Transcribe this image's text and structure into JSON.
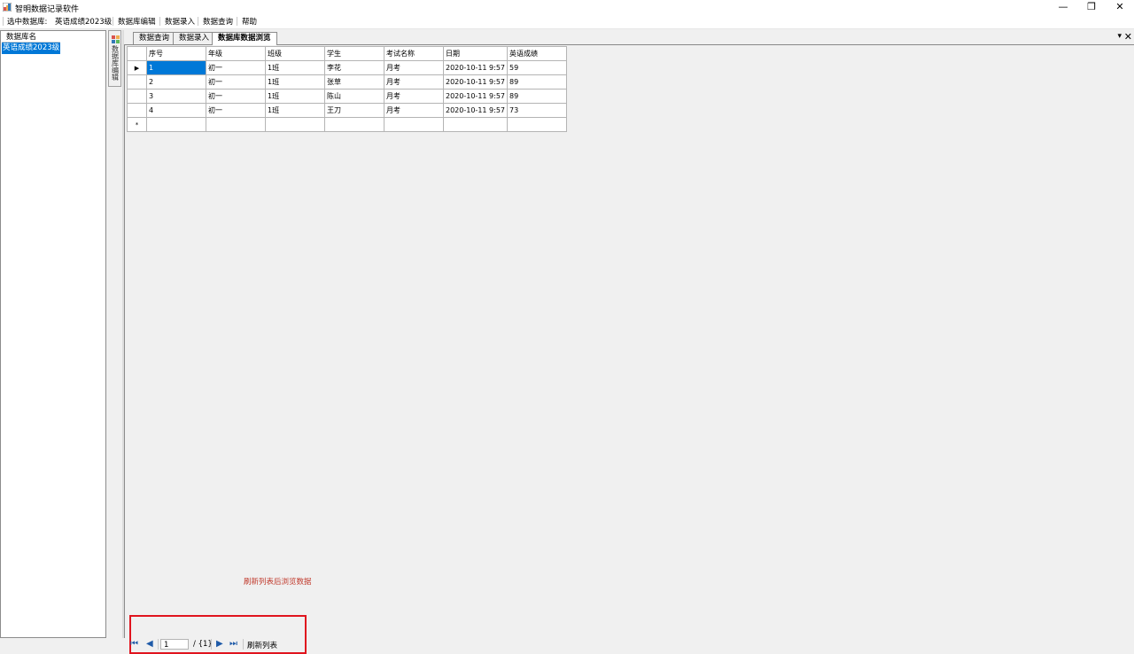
{
  "window": {
    "title": "智明数据记录软件",
    "minimize": "—",
    "restore": "❐",
    "close": "✕"
  },
  "menu": {
    "selected_db_label": "选中数据库:",
    "selected_db_value": "英语成绩2023级",
    "items": [
      "数据库编辑",
      "数据录入",
      "数据查询",
      "帮助"
    ]
  },
  "db_list": {
    "header": "数据库名",
    "items": [
      "英语成绩2023级"
    ]
  },
  "side_tab": {
    "label": "数据库编辑"
  },
  "tabs": [
    "数据查询",
    "数据录入",
    "数据库数据浏览"
  ],
  "grid": {
    "columns": [
      "序号",
      "年级",
      "班级",
      "学生",
      "考试名称",
      "日期",
      "英语成绩"
    ],
    "rows": [
      [
        "1",
        "初一",
        "1班",
        "李花",
        "月考",
        "2020-10-11 9:57",
        "59"
      ],
      [
        "2",
        "初一",
        "1班",
        "张草",
        "月考",
        "2020-10-11 9:57",
        "89"
      ],
      [
        "3",
        "初一",
        "1班",
        "陈山",
        "月考",
        "2020-10-11 9:57",
        "89"
      ],
      [
        "4",
        "初一",
        "1班",
        "王刀",
        "月考",
        "2020-10-11 9:57",
        "73"
      ]
    ],
    "current_row_marker": "▶",
    "new_row_marker": "*"
  },
  "hint_text": "刷新列表后浏览数据",
  "navigator": {
    "position": "1",
    "count": "/ {1}",
    "refresh_label": "刷新列表"
  },
  "colors": {
    "selection": "#0078d7",
    "hint": "#c0392b",
    "highlight_box": "#e0141e"
  }
}
